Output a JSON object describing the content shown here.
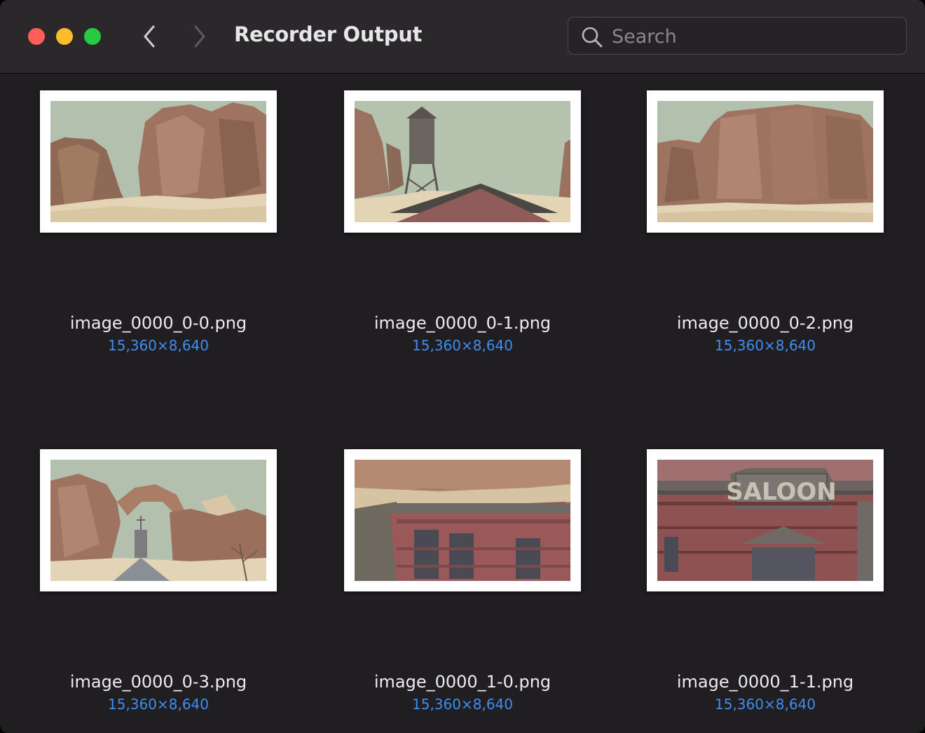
{
  "window": {
    "title": "Recorder Output"
  },
  "search": {
    "placeholder": "Search",
    "value": ""
  },
  "colors": {
    "background": "#201e21",
    "titlebar": "#2a282b",
    "accent": "#3d8ef0",
    "close": "#ff5f57",
    "minimize": "#febc2e",
    "maximize": "#28c840"
  },
  "icons": [
    "chevron-left-icon",
    "chevron-right-icon",
    "search-icon"
  ],
  "files": [
    {
      "name": "image_0000_0-0.png",
      "dims": "15,360×8,640",
      "thumb": "cliffs-and-sand"
    },
    {
      "name": "image_0000_0-1.png",
      "dims": "15,360×8,640",
      "thumb": "water-tower"
    },
    {
      "name": "image_0000_0-2.png",
      "dims": "15,360×8,640",
      "thumb": "mesa-wall"
    },
    {
      "name": "image_0000_0-3.png",
      "dims": "15,360×8,640",
      "thumb": "rock-arch-church"
    },
    {
      "name": "image_0000_1-0.png",
      "dims": "15,360×8,640",
      "thumb": "red-building"
    },
    {
      "name": "image_0000_1-1.png",
      "dims": "15,360×8,640",
      "thumb": "saloon",
      "thumb_text": "SALOON"
    }
  ]
}
